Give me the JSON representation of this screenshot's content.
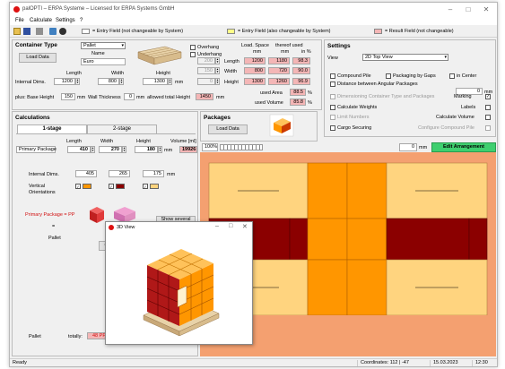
{
  "window": {
    "title": "palOPTI – ERPA Systeme – Licensed for ERPA Systems GmbH",
    "minimize": "–",
    "maximize": "□",
    "close": "✕"
  },
  "menu": {
    "file": "File",
    "calculate": "Calculate",
    "settings": "Settings",
    "help": "?"
  },
  "legend": {
    "entry_not_changeable": "= Entry Field (not changeable by System)",
    "entry_changeable": "= Entry Field (also changeable by System)",
    "result_field": "= Result Field (not changeable)",
    "colors": {
      "white": "#ffffff",
      "yellow": "#ffff88",
      "pink": "#f4b6b6"
    }
  },
  "container": {
    "header": "Container Type",
    "type_value": "Pallet",
    "load_data_button": "Load Data",
    "name_label": "Name",
    "name_value": "Euro",
    "length_label": "Length",
    "width_label": "Width",
    "height_label": "Height",
    "internal_dims_label": "Internal Dims.",
    "length": "1200",
    "width": "800",
    "height": "1300",
    "unit": "mm",
    "base_height_label": "plus: Base Height",
    "base_height": "150",
    "base_unit": "mm",
    "wall_thickness_label": "Wall Thickness",
    "wall_thickness": "0",
    "wall_unit": "mm",
    "allowed_total_height_label": "allowed total Height",
    "allowed_total_height": "1450",
    "allowed_unit": "mm"
  },
  "overhang": {
    "overhang_label": "Overhang",
    "underhang_label": "Underhang",
    "load_space_label": "Load. Space",
    "thereof_used_label": "thereof used",
    "col_mm1": "mm",
    "col_mm2": "mm",
    "col_pct": "in %",
    "rows": [
      {
        "spin": "200",
        "label": "Length",
        "space": "1200",
        "used": "1180",
        "pct": "98.3"
      },
      {
        "spin": "150",
        "label": "Width",
        "space": "800",
        "used": "720",
        "pct": "90.0"
      },
      {
        "spin": "0",
        "label": "Height",
        "space": "1300",
        "used": "1260",
        "pct": "96.9"
      }
    ],
    "used_area_label": "used Area",
    "used_area": "88.5",
    "used_area_unit": "%",
    "used_volume_label": "used Volume",
    "used_volume": "85.8",
    "used_volume_unit": "%"
  },
  "settings": {
    "header": "Settings",
    "view_label": "View",
    "view_value": "2D Top View",
    "compound_pile": "Compound Pile",
    "packaging_by_gaps": "Packaging by Gaps",
    "in_center": "in Center",
    "distance_between": "Distance between Angular Packages",
    "distance_value": "0",
    "distance_unit": "mm",
    "dimensioning": "Dimensioning Container Type and Packages",
    "marking": "Marking",
    "calc_weights": "Calculate Weights",
    "labels": "Labels",
    "limit_numbers": "Limit Numbers",
    "calc_volume": "Calculate Volume",
    "cargo_securing": "Cargo Securing",
    "configure_compound": "Configure Compound Pile",
    "check_mark": "✓"
  },
  "calculations": {
    "header": "Calculations",
    "tab1": "1-stage",
    "tab2": "2-stage",
    "length_label": "Length",
    "width_label": "Width",
    "height_label": "Height",
    "volume_label": "Volume [ml]",
    "primary_package_label": "Primary Package",
    "length": "410",
    "width": "270",
    "height": "180",
    "volume": "19926",
    "unit": "mm",
    "internal_dims_label": "Internal Dims.",
    "int_length": "405",
    "int_width": "265",
    "int_height": "175",
    "int_unit": "mm",
    "vertical_label": "Vertical",
    "orientations_label": "Orientations",
    "primary_pp": "Primary Package = PP",
    "pallet_label": "Pallet",
    "show_several": "Show several",
    "calc_button": "Calc",
    "pallet_footer_label": "Pallet",
    "totally_label": "totally:",
    "totally_value": "48",
    "totally_unit": "PP",
    "eq": "="
  },
  "packages": {
    "header": "Packages",
    "load_data_button": "Load Data",
    "zoom": "100%",
    "edit_mm_value": "0",
    "edit_mm_unit": "mm",
    "edit_arrangement": "Edit Arrangement"
  },
  "popup": {
    "title": "3D View",
    "minimize": "–",
    "maximize": "□",
    "close": "✕"
  },
  "status": {
    "ready": "Ready",
    "coordinates": "Coordinates: 112 | -47",
    "date": "15.03.2023",
    "time": "12:30"
  },
  "colors": {
    "box_orange": "#ff9600",
    "box_tan": "#ffd47f",
    "box_dark": "#8b0000",
    "green": "#3fcf6f",
    "red_accent": "#d11111"
  }
}
